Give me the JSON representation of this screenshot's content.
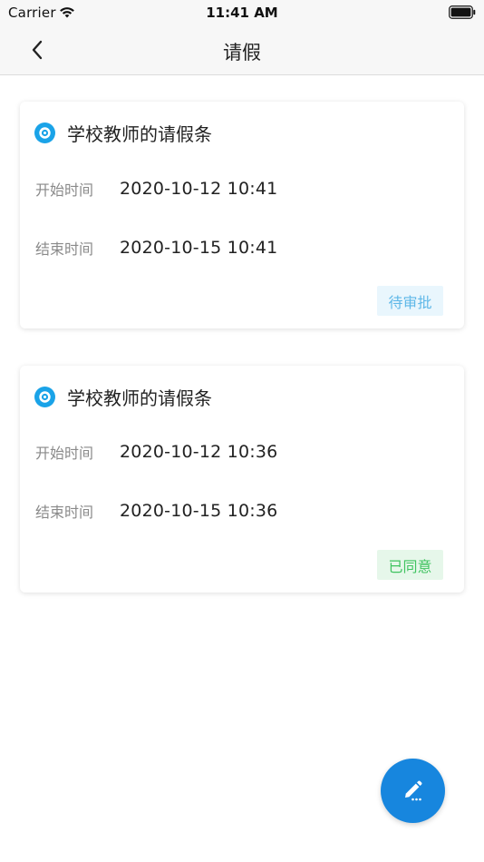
{
  "status_bar": {
    "carrier": "Carrier",
    "time": "11:41 AM"
  },
  "nav": {
    "title": "请假",
    "back_icon": "chevron-left-icon"
  },
  "leaves": [
    {
      "title": "学校教师的请假条",
      "start_label": "开始时间",
      "start_value": "2020-10-12 10:41",
      "end_label": "结束时间",
      "end_value": "2020-10-15 10:41",
      "status": "待审批",
      "status_kind": "pending"
    },
    {
      "title": "学校教师的请假条",
      "start_label": "开始时间",
      "start_value": "2020-10-12 10:36",
      "end_label": "结束时间",
      "end_value": "2020-10-15 10:36",
      "status": "已同意",
      "status_kind": "approved"
    }
  ],
  "fab": {
    "icon": "edit-icon"
  },
  "colors": {
    "accent": "#1786de",
    "app_icon": "#1aa3e8",
    "pending_text": "#5fb8e8",
    "pending_bg": "#e9f6fd",
    "approved_text": "#3fc35f",
    "approved_bg": "#e6f7ea"
  }
}
